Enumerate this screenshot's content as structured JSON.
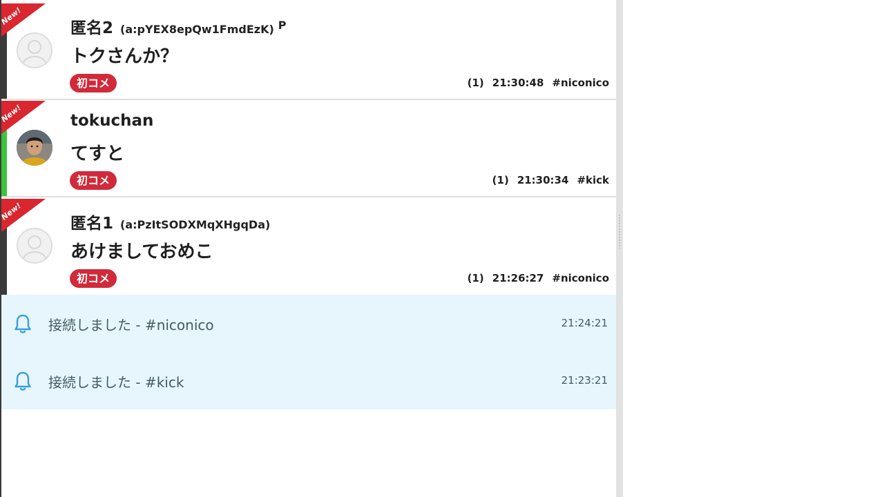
{
  "comments": [
    {
      "name": "匿名2",
      "user_id": "(a:pYEX8epQw1FmdEzK)",
      "premium_mark": "P",
      "message": "トクさんか？",
      "badge": "初コメ",
      "count": "(1)",
      "time": "21:30:48",
      "channel": "#niconico",
      "new_label": "New!",
      "avatar": "blank-avatar-icon",
      "side_color": "#3a3a3a"
    },
    {
      "name": "tokuchan",
      "user_id": "",
      "premium_mark": "",
      "message": "てすと",
      "badge": "初コメ",
      "count": "(1)",
      "time": "21:30:34",
      "channel": "#kick",
      "new_label": "New!",
      "avatar": "user-photo",
      "side_color": "#3bc43b"
    },
    {
      "name": "匿名1",
      "user_id": "(a:PzItSODXMqXHgqDa)",
      "premium_mark": "",
      "message": "あけましておめこ",
      "badge": "初コメ",
      "count": "(1)",
      "time": "21:26:27",
      "channel": "#niconico",
      "new_label": "New!",
      "avatar": "blank-avatar-icon",
      "side_color": "#3a3a3a"
    }
  ],
  "notices": [
    {
      "text": "接続しました - #niconico",
      "time": "21:24:21",
      "icon": "bell-icon"
    },
    {
      "text": "接続しました - #kick",
      "time": "21:23:21",
      "icon": "bell-icon"
    }
  ],
  "colors": {
    "new_ribbon": "#d9262f",
    "badge": "#d12a3a",
    "notice_bg": "#e6f6fc",
    "bell": "#3a9fd8"
  }
}
